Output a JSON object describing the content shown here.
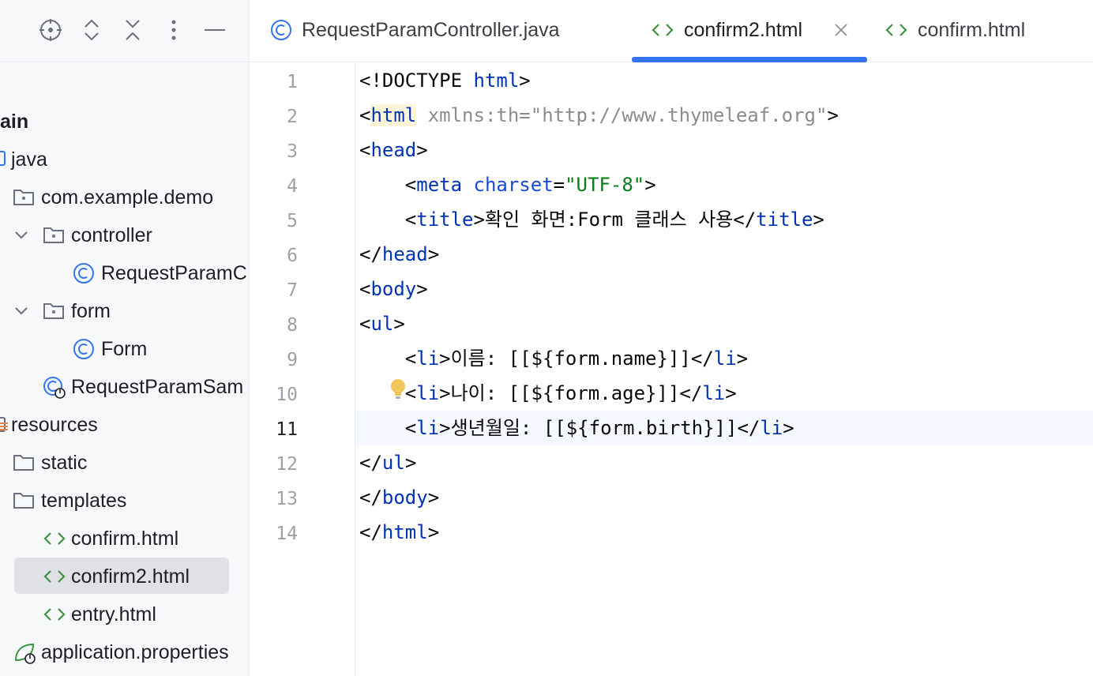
{
  "project": {
    "toolbar": {
      "locate_icon": "crosshair-icon",
      "expand_icon": "expand-all-icon",
      "collapse_icon": "collapse-all-icon",
      "options_icon": "more-vertical-icon",
      "hide_icon": "minimize-icon"
    },
    "tree": [
      {
        "label": "ain",
        "icon": "none"
      },
      {
        "label": "java",
        "icon": "source-folder-icon"
      },
      {
        "label": "com.example.demo",
        "icon": "package-icon"
      },
      {
        "label": "controller",
        "icon": "package-icon",
        "expanded": true
      },
      {
        "label": "RequestParamC",
        "icon": "class-icon"
      },
      {
        "label": "form",
        "icon": "package-icon",
        "expanded": true
      },
      {
        "label": "Form",
        "icon": "class-icon"
      },
      {
        "label": "RequestParamSam",
        "icon": "spring-app-class-icon"
      },
      {
        "label": "resources",
        "icon": "resources-folder-icon"
      },
      {
        "label": "static",
        "icon": "folder-icon"
      },
      {
        "label": "templates",
        "icon": "folder-icon"
      },
      {
        "label": "confirm.html",
        "icon": "html-file-icon"
      },
      {
        "label": "confirm2.html",
        "icon": "html-file-icon",
        "selected": true
      },
      {
        "label": "entry.html",
        "icon": "html-file-icon"
      },
      {
        "label": "application.properties",
        "icon": "spring-properties-icon"
      }
    ]
  },
  "tabs": [
    {
      "label": "RequestParamController.java",
      "icon": "class-icon",
      "active": false
    },
    {
      "label": "confirm2.html",
      "icon": "html-file-icon",
      "active": true,
      "close_icon": "close-icon"
    },
    {
      "label": "confirm.html",
      "icon": "html-file-icon",
      "active": false
    }
  ],
  "editor": {
    "current_line": 11,
    "line_numbers": [
      "1",
      "2",
      "3",
      "4",
      "5",
      "6",
      "7",
      "8",
      "9",
      "10",
      "11",
      "12",
      "13",
      "14"
    ],
    "lines": [
      "<!DOCTYPE html>",
      "<html xmlns:th=\"http://www.thymeleaf.org\">",
      "<head>",
      "    <meta charset=\"UTF-8\">",
      "    <title>확인 화면:Form 클래스 사용</title>",
      "</head>",
      "<body>",
      "<ul>",
      "    <li>이름: [[${form.name}]]</li>",
      "    <li>나이: [[${form.age}]]</li>",
      "    <li>생년월일: [[${form.birth}]]</li>",
      "</ul>",
      "</body>",
      "</html>"
    ],
    "intention_icon": "lightbulb-icon"
  },
  "colors": {
    "accent": "#3574f0",
    "tag": "#0033b3",
    "string": "#067d17",
    "html_icon": "#3f9142",
    "class_icon": "#3574f0"
  }
}
